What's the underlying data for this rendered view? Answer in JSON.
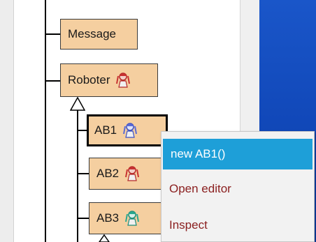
{
  "tree": {
    "nodes": [
      {
        "id": "message",
        "label": "Message",
        "icon": null
      },
      {
        "id": "roboter",
        "label": "Roboter",
        "icon": "robot-girl-red-icon"
      },
      {
        "id": "ab1",
        "label": "AB1",
        "icon": "robot-girl-blue-icon",
        "selected": true
      },
      {
        "id": "ab2",
        "label": "AB2",
        "icon": "robot-girl-red-icon"
      },
      {
        "id": "ab3",
        "label": "AB3",
        "icon": "robot-girl-teal-icon"
      }
    ]
  },
  "context_menu": {
    "items": [
      {
        "label": "new AB1()",
        "highlighted": true
      },
      {
        "label": "Open editor",
        "highlighted": false
      },
      {
        "label": "Inspect",
        "highlighted": false
      }
    ]
  },
  "colors": {
    "node_fill": "#f5cfa0",
    "menu_highlight": "#1e9fd8",
    "menu_text": "#8b2020",
    "panel_blue": "#1148b9"
  }
}
